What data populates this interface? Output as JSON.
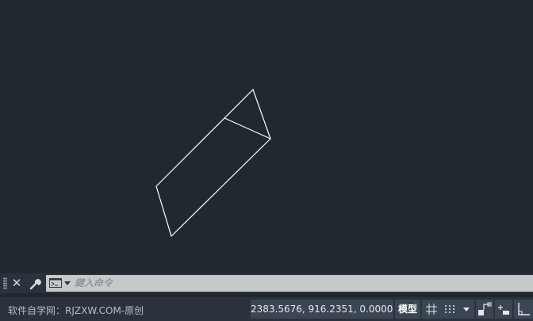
{
  "command_line": {
    "close_icon": "close-icon",
    "customize_icon": "wrench-icon",
    "prompt_icon": "command-prompt-icon",
    "input_placeholder": "鍵入命令",
    "input_value": ""
  },
  "status_bar": {
    "watermark": "软件自学网：RJZXW.COM-原创",
    "coordinates": "2383.5676, 916.2351, 0.0000",
    "model_label": "模型",
    "buttons": [
      "grid-icon",
      "snap-icon",
      "chevron-down-icon",
      "infer-constraints-icon",
      "dynamic-input-icon",
      "ortho-icon"
    ]
  },
  "colors": {
    "canvas_background": "#212830",
    "bar_background": "#2b323b",
    "button_background": "#3b4553",
    "geometry_stroke": "#ffffff",
    "command_input_background": "#c6c8ca"
  }
}
